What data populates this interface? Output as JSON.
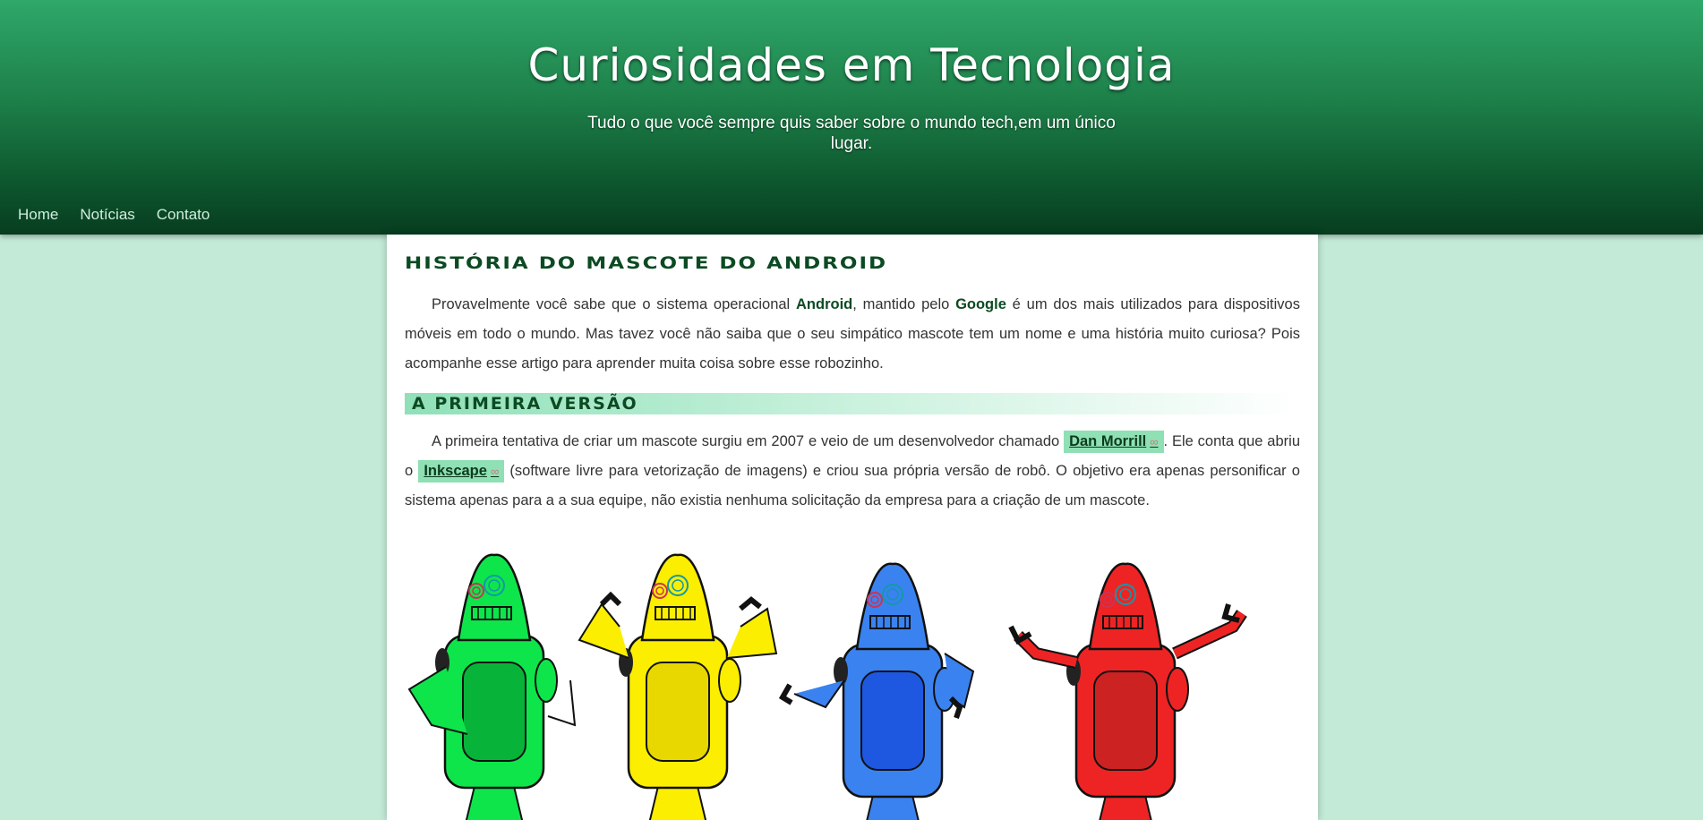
{
  "header": {
    "title": "Curiosidades em Tecnologia",
    "subtitle": "Tudo o que você sempre quis saber sobre o mundo tech,em um único lugar."
  },
  "nav": {
    "items": [
      {
        "label": "Home"
      },
      {
        "label": "Notícias"
      },
      {
        "label": "Contato"
      }
    ]
  },
  "article": {
    "title": "História do Mascote do Android",
    "p1": {
      "t1": "Provavelmente você sabe que o sistema operacional ",
      "android": "Android",
      "t2": ", mantido pelo ",
      "google": "Google",
      "t3": " é um dos mais utilizados para dispositivos móveis em todo o mundo. Mas tavez você não saiba que o seu simpático mascote tem um nome e uma história muito curiosa? Pois acompanhe esse artigo para aprender muita coisa sobre esse robozinho."
    },
    "section1": {
      "title": "A primeira versão",
      "t1": "A primeira tentativa de criar um mascote surgiu em 2007 e veio de um desenvolvedor chamado ",
      "link1": "Dan Morrill",
      "t2": ". Ele conta que abriu o ",
      "link2": "Inkscape",
      "t3": " (software livre para vetorização de imagens) e criou sua própria versão de robô. O objetivo era apenas personificar o sistema apenas para a a sua equipe, não existia nenhuma solicitação da empresa para a criação de um mascote."
    }
  },
  "colors": {
    "accent": "#0b4a22",
    "chip": "#8fe0b4",
    "robot_green": "#0ee54b",
    "robot_yellow": "#fbee00",
    "robot_blue": "#3a82f0",
    "robot_red": "#ee2424"
  },
  "icons": {
    "external_link": "chain-link-icon"
  }
}
